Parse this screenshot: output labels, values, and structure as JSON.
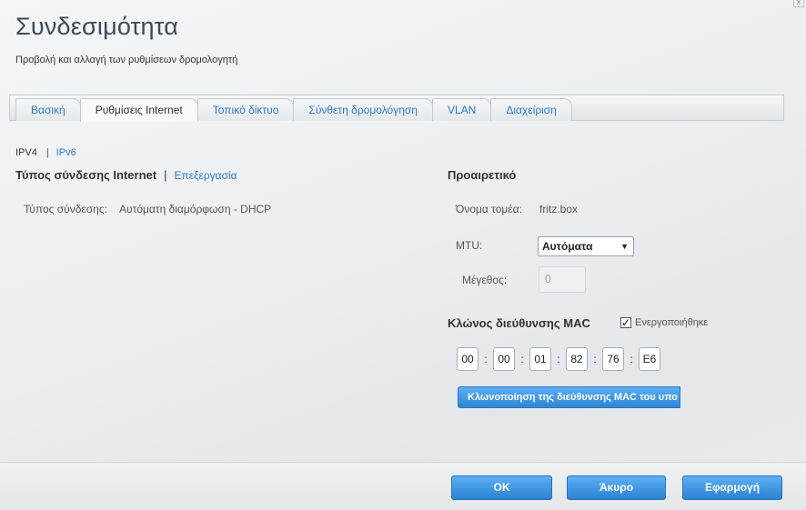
{
  "page": {
    "title": "Συνδεσιμότητα",
    "subtitle": "Προβολή και αλλαγή των ρυθμίσεων δρομολογητή"
  },
  "tabs": [
    {
      "label": "Βασική",
      "active": false
    },
    {
      "label": "Ρυθμίσεις Internet",
      "active": true
    },
    {
      "label": "Τοπικό δίκτυο",
      "active": false
    },
    {
      "label": "Σύνθετη δρομολόγηση",
      "active": false
    },
    {
      "label": "VLAN",
      "active": false
    },
    {
      "label": "Διαχείριση",
      "active": false
    }
  ],
  "protocols": {
    "ipv4": "IPV4",
    "separator": "|",
    "ipv6": "IPv6"
  },
  "connection": {
    "heading": "Τύπος σύνδεσης Internet",
    "separator": "|",
    "edit_link": "Επεξεργασία",
    "type_label": "Τύπος σύνδεσης:",
    "type_value": "Αυτόματη διαμόρφωση - DHCP"
  },
  "optional": {
    "heading": "Προαιρετικό",
    "domain_label": "Όνομα τομέα:",
    "domain_value": "fritz.box",
    "mtu_label": "MTU:",
    "mtu_value": "Αυτόματα",
    "size_label": "Μέγεθος:",
    "size_value": "0"
  },
  "mac_clone": {
    "heading": "Κλώνος διεύθυνσης MAC",
    "enabled_label": "Ενεργοποιήθηκε",
    "enabled": true,
    "octets": [
      "00",
      "00",
      "01",
      "82",
      "76",
      "E6"
    ],
    "separator": ":",
    "clone_button": "Κλωνοποίηση της διεύθυνσης MAC του υπο"
  },
  "footer": {
    "ok": "OK",
    "cancel": "Άκυρο",
    "apply": "Εφαρμογή"
  },
  "colors": {
    "accent_blue": "#2e7bbf",
    "button_blue": "#3a8fdc",
    "title": "#3c4a5a"
  }
}
